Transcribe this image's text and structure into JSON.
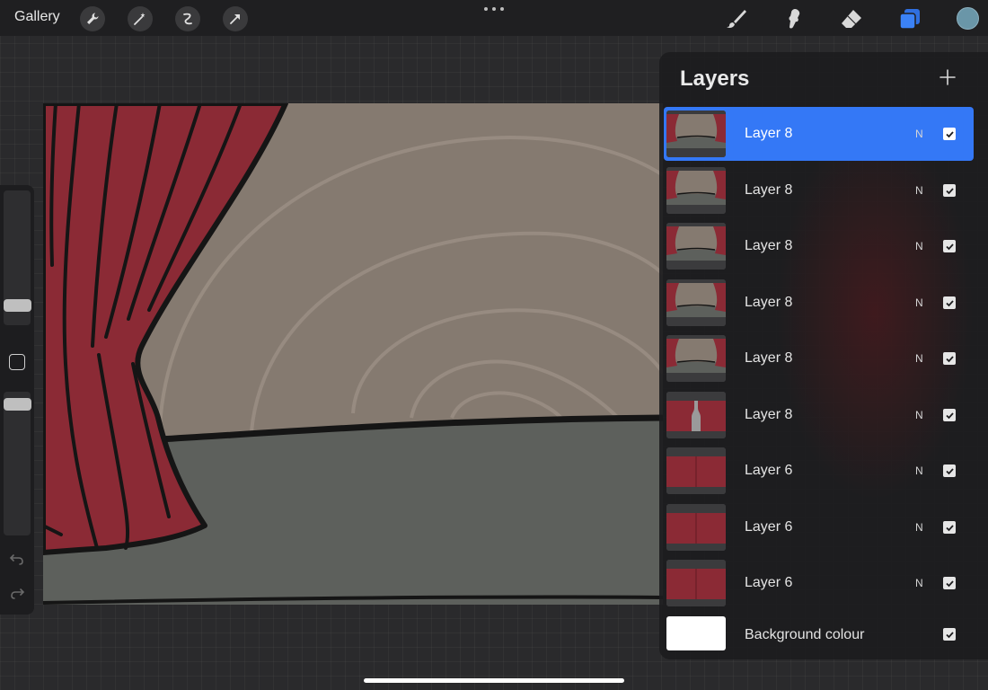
{
  "topbar": {
    "gallery_label": "Gallery",
    "tools_left": [
      "wrench-icon",
      "magic-wand-icon",
      "selection-icon",
      "transform-arrow-icon"
    ],
    "tools_right": [
      "brush-icon",
      "smudge-icon",
      "eraser-icon",
      "layers-icon"
    ],
    "active_tool": "layers-icon",
    "current_color": "#6a96a8"
  },
  "layers": {
    "title": "Layers",
    "items": [
      {
        "name": "Layer 8",
        "blend": "N",
        "visible": true,
        "selected": true,
        "thumb": "stage"
      },
      {
        "name": "Layer 8",
        "blend": "N",
        "visible": true,
        "selected": false,
        "thumb": "stage"
      },
      {
        "name": "Layer 8",
        "blend": "N",
        "visible": true,
        "selected": false,
        "thumb": "stage"
      },
      {
        "name": "Layer 8",
        "blend": "N",
        "visible": true,
        "selected": false,
        "thumb": "stage"
      },
      {
        "name": "Layer 8",
        "blend": "N",
        "visible": true,
        "selected": false,
        "thumb": "stage"
      },
      {
        "name": "Layer 8",
        "blend": "N",
        "visible": true,
        "selected": false,
        "thumb": "bottle"
      },
      {
        "name": "Layer 6",
        "blend": "N",
        "visible": true,
        "selected": false,
        "thumb": "curtain"
      },
      {
        "name": "Layer 6",
        "blend": "N",
        "visible": true,
        "selected": false,
        "thumb": "curtain"
      },
      {
        "name": "Layer 6",
        "blend": "N",
        "visible": true,
        "selected": false,
        "thumb": "curtain"
      }
    ],
    "background": {
      "name": "Background colour",
      "visible": true,
      "color": "#ffffff"
    }
  },
  "colors": {
    "accent": "#3478f6",
    "curtain": "#8b2a35",
    "wall": "#857a70",
    "floor": "#5d605c"
  }
}
